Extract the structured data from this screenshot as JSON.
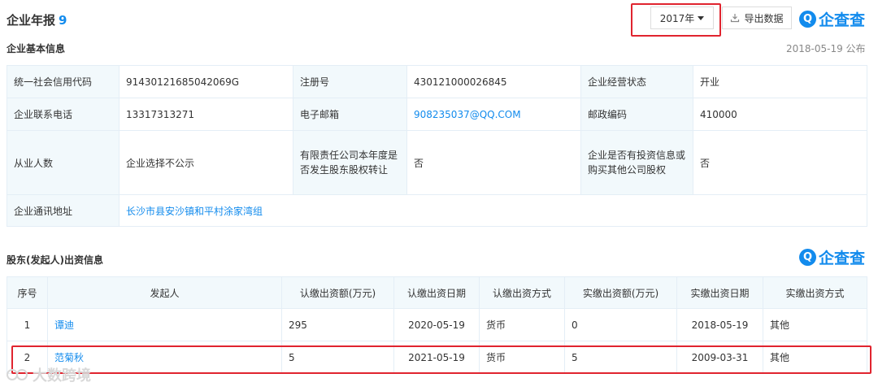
{
  "header": {
    "title": "企业年报",
    "count": "9",
    "year_select": "2017年",
    "export_label": "导出数据",
    "logo_text": "企查查",
    "logo_mark": "Q"
  },
  "basic": {
    "section_title": "企业基本信息",
    "publish_date": "2018-05-19 公布",
    "rows": [
      [
        "统一社会信用代码",
        "91430121685042069G",
        "注册号",
        "430121000026845",
        "企业经营状态",
        "开业"
      ],
      [
        "企业联系电话",
        "13317313271",
        "电子邮箱",
        "908235037@QQ.COM",
        "邮政编码",
        "410000"
      ],
      [
        "从业人数",
        "企业选择不公示",
        "有限责任公司本年度是否发生股东股权转让",
        "否",
        "企业是否有投资信息或购买其他公司股权",
        "否"
      ]
    ],
    "address_label": "企业通讯地址",
    "address_value": "长沙市县安沙镇和平村涂家湾组"
  },
  "shareholders": {
    "section_title": "股东(发起人)出资信息",
    "logo_text": "企查查",
    "columns": [
      "序号",
      "发起人",
      "认缴出资额(万元)",
      "认缴出资日期",
      "认缴出资方式",
      "实缴出资额(万元)",
      "实缴出资日期",
      "实缴出资方式"
    ],
    "rows": [
      [
        "1",
        "谭迪",
        "295",
        "2020-05-19",
        "货币",
        "0",
        "2018-05-19",
        "其他"
      ],
      [
        "2",
        "范菊秋",
        "5",
        "2021-05-19",
        "货币",
        "5",
        "2009-03-31",
        "其他"
      ]
    ]
  },
  "watermark": "大数跨境",
  "colors": {
    "accent": "#128bed",
    "highlight_box": "#e0242f",
    "label_bg": "#f2f9fc",
    "border": "#e4eef6"
  }
}
